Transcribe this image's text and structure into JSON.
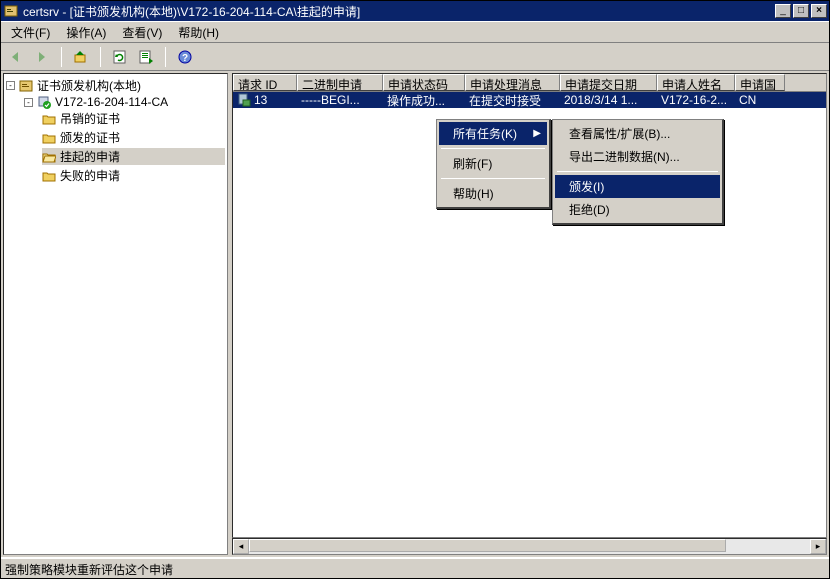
{
  "title": "certsrv - [证书颁发机构(本地)\\V172-16-204-114-CA\\挂起的申请]",
  "menubar": {
    "file": "文件(F)",
    "action": "操作(A)",
    "view": "查看(V)",
    "help": "帮助(H)"
  },
  "tree": {
    "root": "证书颁发机构(本地)",
    "ca": "V172-16-204-114-CA",
    "nodes": {
      "revoked": "吊销的证书",
      "issued": "颁发的证书",
      "pending": "挂起的申请",
      "failed": "失败的申请"
    }
  },
  "columns": [
    "请求 ID",
    "二进制申请",
    "申请状态码",
    "申请处理消息",
    "申请提交日期",
    "申请人姓名",
    "申请国"
  ],
  "row": {
    "id": "13",
    "binary": "-----BEGI...",
    "status": "操作成功...",
    "msg": "在提交时接受",
    "date": "2018/3/14 1...",
    "requester": "V172-16-2...",
    "country": "CN"
  },
  "ctx1": {
    "all_tasks": "所有任务(K)",
    "refresh": "刷新(F)",
    "help": "帮助(H)"
  },
  "ctx2": {
    "view_attr": "查看属性/扩展(B)...",
    "export_bin": "导出二进制数据(N)...",
    "issue": "颁发(I)",
    "deny": "拒绝(D)"
  },
  "status": "强制策略模块重新评估这个申请"
}
